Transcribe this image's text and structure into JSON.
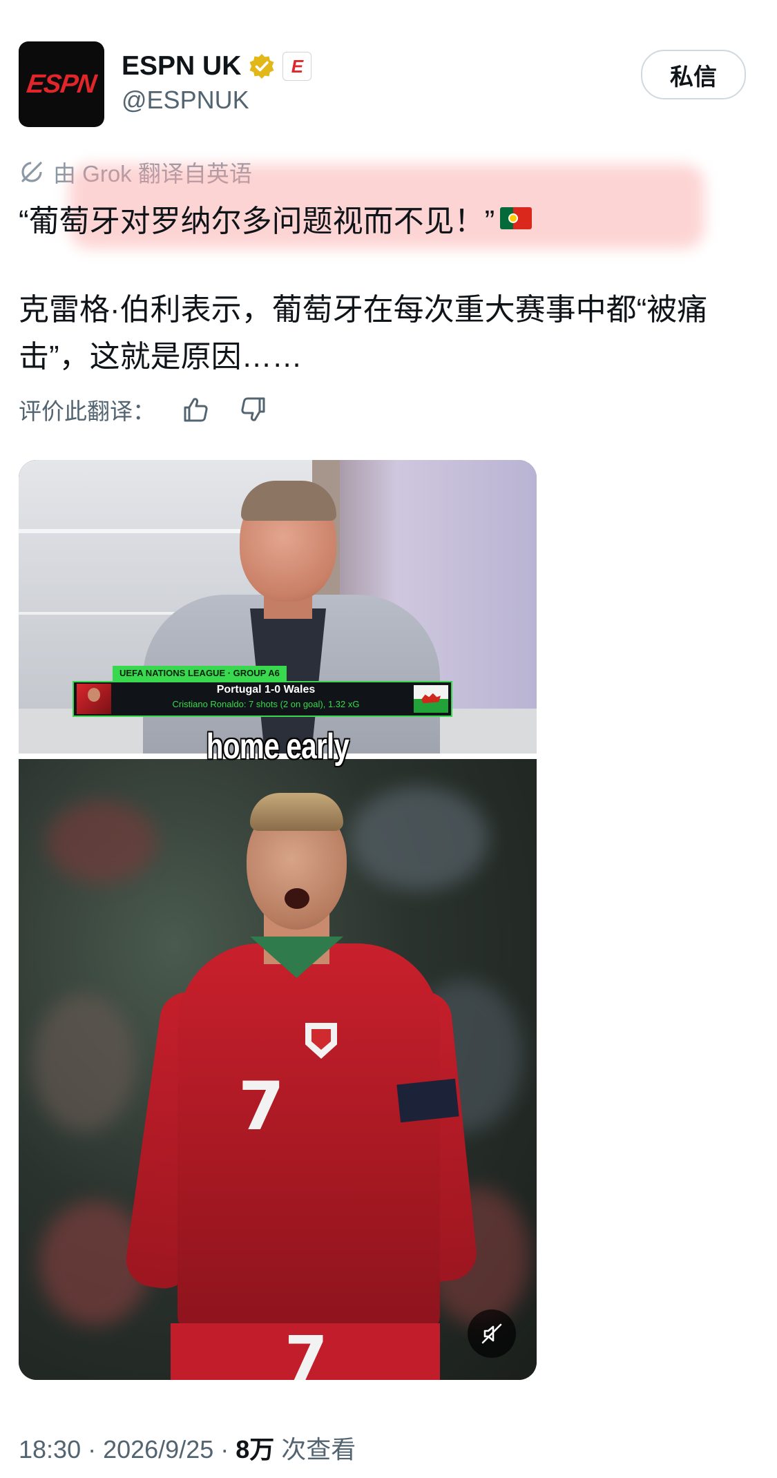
{
  "account": {
    "display_name": "ESPN UK",
    "handle": "@ESPNUK",
    "avatar_text": "ESPN",
    "affiliate_badge": "E",
    "dm_label": "私信"
  },
  "translation": {
    "notice": "由 Grok 翻译自英语",
    "rate_label": "评价此翻译："
  },
  "post": {
    "headline": "“葡萄牙对罗纳尔多问题视而不见！”",
    "body": "克雷格·伯利表示，葡萄牙在每次重大赛事中都“被痛击”，这就是原因……"
  },
  "media": {
    "lower_third_tag": "UEFA NATIONS LEAGUE · GROUP A6",
    "lower_third_score": "Portugal 1-0 Wales",
    "lower_third_stat": "Cristiano Ronaldo: 7 shots (2 on goal), 1.32 xG",
    "caption": "home early",
    "jersey_number": "7"
  },
  "meta": {
    "time": "18:30",
    "separator": "·",
    "date": "2026/9/25",
    "views_count": "8万",
    "views_label": "次查看"
  },
  "icons": {
    "verified": "verified-badge-icon",
    "grok": "grok-icon",
    "thumbs_up": "thumbs-up-icon",
    "thumbs_down": "thumbs-down-icon",
    "mute": "mute-icon",
    "flag": "portugal-flag-icon"
  },
  "colors": {
    "verified_gold": "#e2b719",
    "espn_red": "#e0262b",
    "secondary_text": "#536471",
    "highlight": "#faa0a0"
  }
}
